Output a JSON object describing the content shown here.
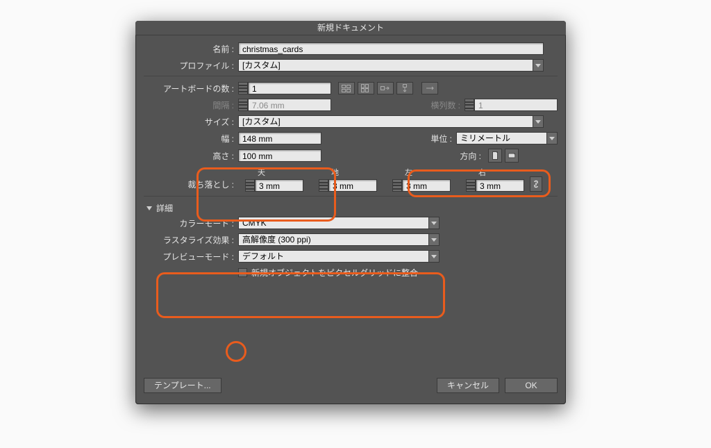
{
  "title": "新規ドキュメント",
  "fields": {
    "name_label": "名前 :",
    "name_value": "christmas_cards",
    "profile_label": "プロファイル :",
    "profile_value": "[カスタム]",
    "artboards_label": "アートボードの数 :",
    "artboards_value": "1",
    "spacing_label": "間隔 :",
    "spacing_value": "7.06 mm",
    "columns_label": "横列数 :",
    "columns_value": "1",
    "size_label": "サイズ :",
    "size_value": "[カスタム]",
    "width_label": "幅 :",
    "width_value": "148 mm",
    "height_label": "高さ :",
    "height_value": "100 mm",
    "units_label": "単位 :",
    "units_value": "ミリメートル",
    "orientation_label": "方向 :",
    "bleed_label": "裁ち落とし :",
    "bleed_top": "天",
    "bleed_bottom": "地",
    "bleed_left": "左",
    "bleed_right": "右",
    "bleed_value": "3 mm"
  },
  "advanced": {
    "section_label": "詳細",
    "colormode_label": "カラーモード :",
    "colormode_value": "CMYK",
    "raster_label": "ラスタライズ効果 :",
    "raster_value": "高解像度 (300 ppi)",
    "preview_label": "プレビューモード :",
    "preview_value": "デフォルト",
    "align_pixel_label": "新規オブジェクトをピクセルグリッドに整合"
  },
  "buttons": {
    "template": "テンプレート...",
    "cancel": "キャンセル",
    "ok": "OK"
  }
}
